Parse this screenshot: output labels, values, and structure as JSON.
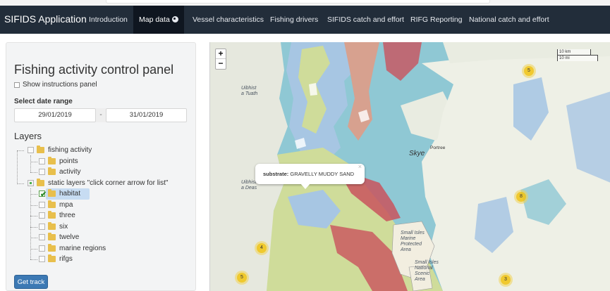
{
  "navbar": {
    "brand": "SIFIDS Application",
    "items": [
      {
        "label": "Introduction",
        "active": false
      },
      {
        "label": "Map data",
        "active": true
      },
      {
        "label": "Vessel characteristics",
        "active": false
      },
      {
        "label": "Fishing drivers",
        "active": false
      },
      {
        "label": "SIFIDS catch and effort",
        "active": false
      },
      {
        "label": "RIFG Reporting",
        "active": false
      },
      {
        "label": "National catch and effort",
        "active": false
      }
    ],
    "active_icon": "globe-icon"
  },
  "sidebar": {
    "title": "Fishing activity control panel",
    "instructions_label": "Show instructions panel",
    "instructions_checked": false,
    "date_range_label": "Select date range",
    "date_start": "29/01/2019",
    "date_separator": "-",
    "date_end": "31/01/2019",
    "layers_title": "Layers",
    "tree": [
      {
        "label": "fishing activity",
        "level": 0,
        "state": "none"
      },
      {
        "label": "points",
        "level": 1,
        "state": "none"
      },
      {
        "label": "activity",
        "level": 1,
        "state": "none"
      },
      {
        "label": "static layers \"click corner arrow for list\"",
        "level": 0,
        "state": "partial"
      },
      {
        "label": "habitat",
        "level": 1,
        "state": "checked",
        "selected": true
      },
      {
        "label": "mpa",
        "level": 1,
        "state": "none"
      },
      {
        "label": "three",
        "level": 1,
        "state": "none"
      },
      {
        "label": "six",
        "level": 1,
        "state": "none"
      },
      {
        "label": "twelve",
        "level": 1,
        "state": "none"
      },
      {
        "label": "marine regions",
        "level": 1,
        "state": "none"
      },
      {
        "label": "rifgs",
        "level": 1,
        "state": "none"
      }
    ],
    "get_track_label": "Get track"
  },
  "map": {
    "zoom_in": "+",
    "zoom_out": "−",
    "scale_km": "10 km",
    "scale_mi": "10 mi",
    "popup": {
      "key": "substrate:",
      "value": "GRAVELLY MUDDY SAND",
      "close": "×"
    },
    "clusters": [
      {
        "count": "5"
      },
      {
        "count": "8"
      },
      {
        "count": "4"
      },
      {
        "count": "5"
      },
      {
        "count": "3"
      }
    ],
    "places": {
      "skye": "Skye",
      "portree": "Portree",
      "uibhist_tuath": [
        "Uibhist",
        "a Tuath"
      ],
      "uibhist_deas": [
        "Uibhist",
        "a Deas"
      ],
      "small_isles_mpa": [
        "Small Isles",
        "Marine",
        "Protected",
        "Area"
      ],
      "small_isles_nsa": [
        "Small Isles",
        "National",
        "Scenic",
        "Area"
      ]
    },
    "colors": {
      "land": "#eef0e6",
      "sand": "#cfdc9a",
      "mud": "#a7c6e3",
      "coarse": "#d7a18f",
      "rock": "#c9535d",
      "muddy_sand": "#8fc8d4",
      "nav_bar": "#222d3a",
      "accent_button": "#3c79b4"
    }
  }
}
